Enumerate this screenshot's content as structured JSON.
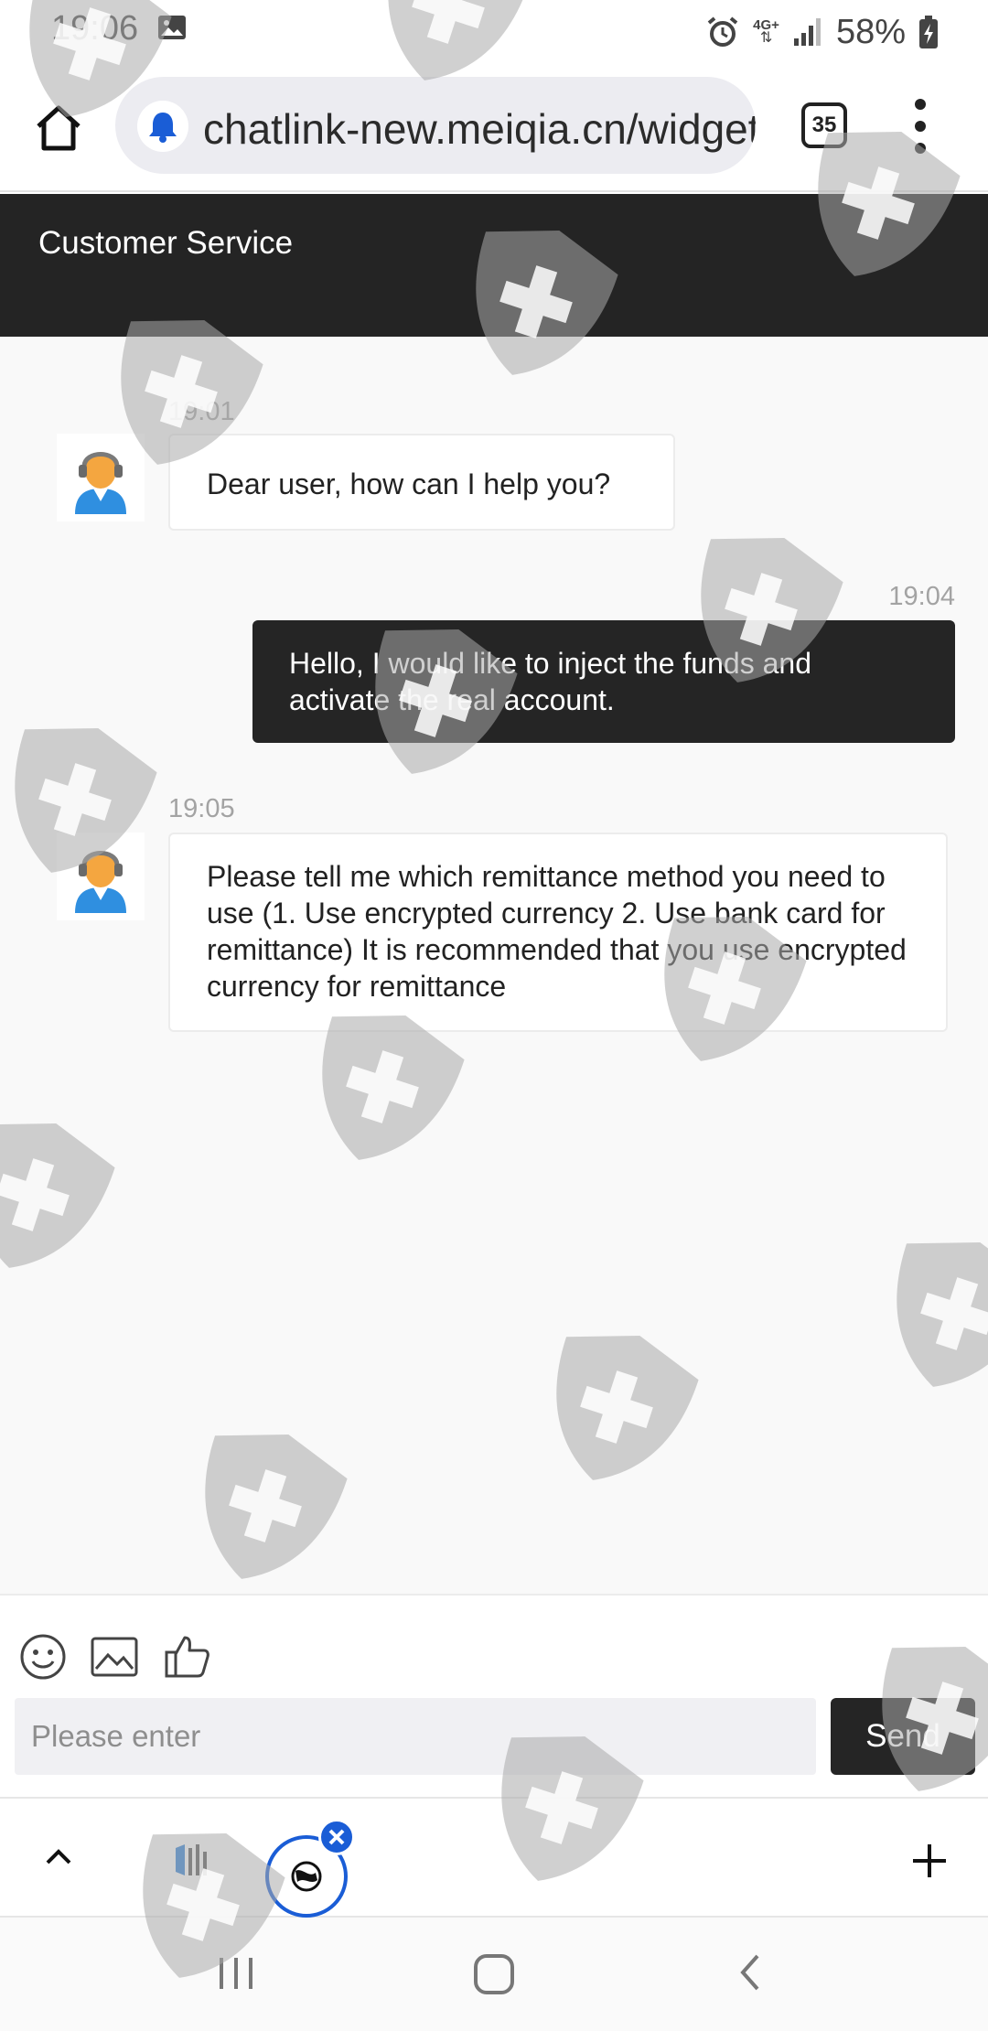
{
  "status_bar": {
    "time": "19:06",
    "network": "4G+",
    "battery": "58%"
  },
  "browser": {
    "url": "chatlink-new.meiqia.cn/widget",
    "tab_count": "35",
    "icons": [
      "home-icon",
      "bell-icon",
      "tabs-icon",
      "more-menu-icon"
    ]
  },
  "header": {
    "title": "Customer Service"
  },
  "messages": [
    {
      "from": "agent",
      "time": "19:01",
      "text": "Dear user, how can I help you?"
    },
    {
      "from": "user",
      "time": "19:04",
      "text": "Hello, I would like to inject the funds and activate the real account."
    },
    {
      "from": "agent",
      "time": "19:05",
      "text": "Please tell me which remittance method you need to use (1. Use encrypted currency 2. Use bank card for remittance) It is recommended that you use encrypted currency for remittance"
    }
  ],
  "composer": {
    "placeholder": "Please enter",
    "send_label": "Send",
    "tool_icons": [
      "emoji-icon",
      "image-icon",
      "thumbs-up-icon"
    ]
  },
  "colors": {
    "header_bg": "#242424",
    "user_bubble": "#252525",
    "active_tab_ring": "#1a5dd6"
  }
}
